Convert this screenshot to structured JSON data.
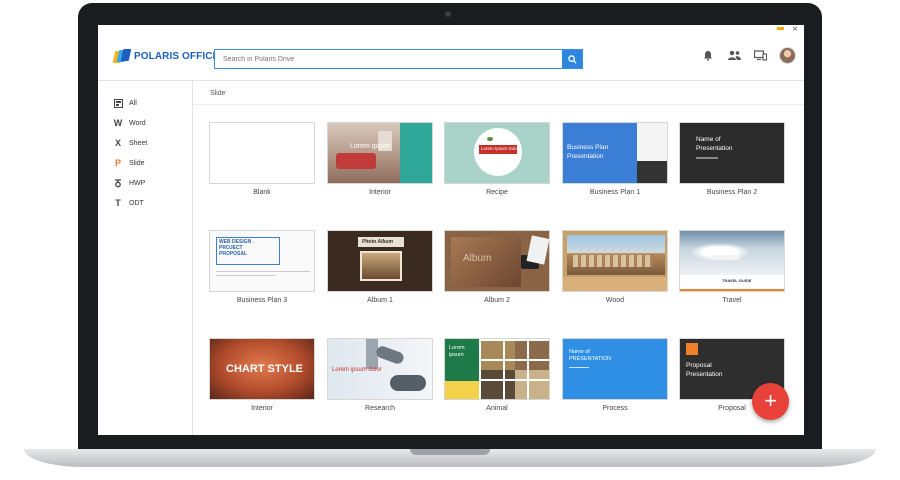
{
  "app": {
    "logo_text": "POLARIS OFFICE",
    "window_close": "×"
  },
  "search": {
    "placeholder": "Search in Polaris Drive"
  },
  "header_icons": [
    "bell-icon",
    "share-users-icon",
    "devices-icon",
    "user-avatar"
  ],
  "sidebar": {
    "items": [
      {
        "label": "All",
        "icon": "all-docs-icon"
      },
      {
        "label": "Word",
        "icon": "word-icon"
      },
      {
        "label": "Sheet",
        "icon": "sheet-icon"
      },
      {
        "label": "Slide",
        "icon": "slide-icon"
      },
      {
        "label": "HWP",
        "icon": "hwp-icon"
      },
      {
        "label": "ODT",
        "icon": "odt-icon"
      }
    ]
  },
  "breadcrumb": "Slide",
  "templates": [
    {
      "label": "Blank"
    },
    {
      "label": "Interior",
      "thumb_text": "Lorem ipsum"
    },
    {
      "label": "Recipe",
      "thumb_text": "Lorem Ipsum Dolor"
    },
    {
      "label": "Business Plan 1",
      "thumb_text": "Business Plan\nPresentation"
    },
    {
      "label": "Business Plan 2",
      "thumb_text": "Name of\nPresentation"
    },
    {
      "label": "Business Plan 3",
      "thumb_text": "WEB DESIGN\nPROJECT\nPROPOSAL"
    },
    {
      "label": "Album 1",
      "thumb_text": "Photo Album"
    },
    {
      "label": "Album 2",
      "thumb_text": "Album"
    },
    {
      "label": "Wood"
    },
    {
      "label": "Travel",
      "thumb_text": "TRAVEL GUIDE"
    },
    {
      "label": "Interior",
      "thumb_text": "CHART STYLE"
    },
    {
      "label": "Research",
      "thumb_text": "Lorem ipsum dolor"
    },
    {
      "label": "Animal",
      "thumb_text": "Lorem\nipsum"
    },
    {
      "label": "Process",
      "thumb_text": "Name of\nPRESENTATION"
    },
    {
      "label": "Proposal",
      "thumb_text": "Proposal\nPresentation"
    }
  ],
  "fab": {
    "label": "+"
  },
  "colors": {
    "accent": "#2e86de",
    "fab": "#e8413a",
    "logo": "#1d5fbf",
    "minimize": "#f2a90f"
  }
}
